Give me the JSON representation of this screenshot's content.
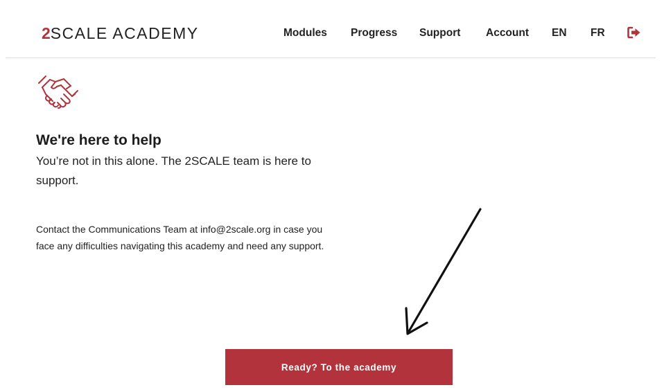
{
  "brand": {
    "number": "2",
    "name": "SCALE ACADEMY",
    "accent_color": "#b3333c"
  },
  "nav": {
    "items": [
      {
        "label": "Modules"
      },
      {
        "label": "Progress"
      },
      {
        "label": "Support"
      },
      {
        "label": "Account"
      },
      {
        "label": "EN",
        "active": true
      },
      {
        "label": "FR"
      }
    ],
    "logout_icon": "sign-out-icon"
  },
  "help": {
    "icon": "handshake-icon",
    "title": "We're here to help",
    "subtitle": "You’re not in this alone. The 2SCALE team is here to support.",
    "contact": "Contact the Communications Team at info@2scale.org in case you face any difficulties navigating this academy and need any support."
  },
  "annotation": {
    "icon": "arrow-down-left-icon"
  },
  "cta": {
    "label": "Ready? To the academy"
  }
}
